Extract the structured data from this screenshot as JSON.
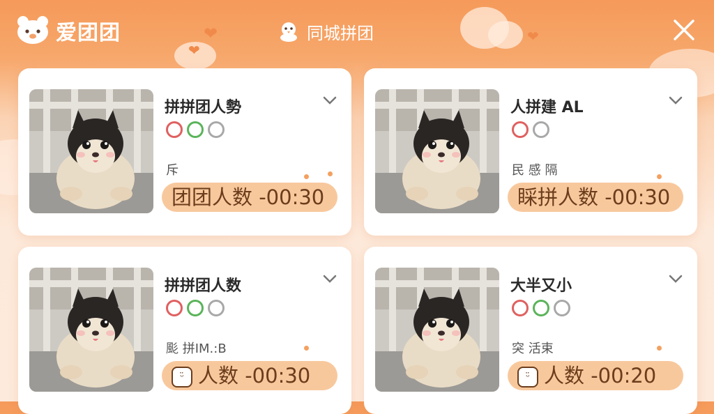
{
  "header": {
    "app_title": "爱团团",
    "center_title": "同城拼团"
  },
  "cards": [
    {
      "title": "拼拼团人勢",
      "subtitle": "斥",
      "pill_text": "团团人数 -00:30"
    },
    {
      "title": "人拼建 AL",
      "subtitle": "民 感 隔",
      "pill_text": "睬拼人数 -00:30"
    },
    {
      "title": "拼拼团人数",
      "subtitle": "颩 拼IM.:B",
      "pill_text": "人数 -00:30"
    },
    {
      "title": "大半又小",
      "subtitle": "突 活束",
      "pill_text": "人数 -00:20"
    }
  ],
  "colors": {
    "header_orange": "#f59a5a",
    "pill_bg": "#f8c89d",
    "tag_red": "#e06060",
    "tag_green": "#5ab45a",
    "tag_gray": "#a8a8a8"
  },
  "icons": {
    "logo": "bear-face-icon",
    "center": "chick-icon",
    "close": "close-icon",
    "expand": "chevron-down-icon"
  }
}
